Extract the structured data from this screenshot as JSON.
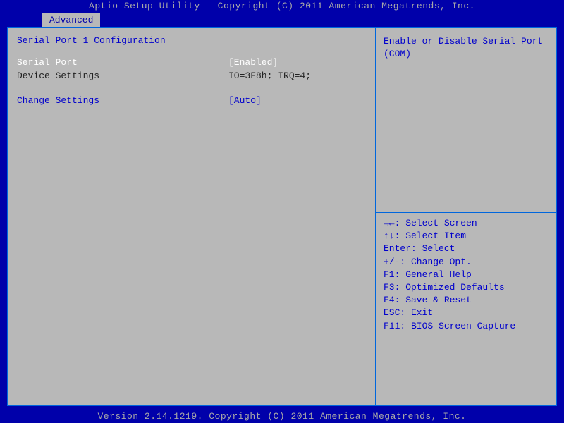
{
  "header": {
    "title": "Aptio Setup Utility – Copyright (C) 2011 American Megatrends, Inc."
  },
  "tabs": {
    "active": "Advanced"
  },
  "main": {
    "section_title": "Serial Port 1 Configuration",
    "rows": {
      "serial_port": {
        "label": "Serial Port",
        "value": "[Enabled]"
      },
      "device_settings": {
        "label": "Device Settings",
        "value": "IO=3F8h; IRQ=4;"
      },
      "change_settings": {
        "label": "Change Settings",
        "value": "[Auto]"
      }
    }
  },
  "help": {
    "line1": "Enable or Disable Serial Port",
    "line2": "(COM)"
  },
  "keys": {
    "k1": "→←: Select Screen",
    "k2": "↑↓: Select Item",
    "k3": "Enter: Select",
    "k4": "+/-: Change Opt.",
    "k5": "F1: General Help",
    "k6": "F3: Optimized Defaults",
    "k7": "F4: Save & Reset",
    "k8": "ESC: Exit",
    "k9": "F11: BIOS Screen Capture"
  },
  "footer": {
    "version": "Version 2.14.1219. Copyright (C) 2011 American Megatrends, Inc."
  }
}
